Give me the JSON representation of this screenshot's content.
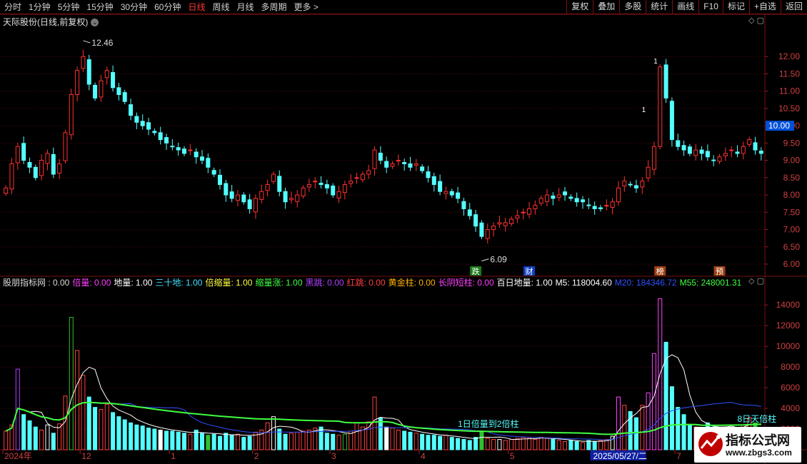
{
  "toolbar": {
    "periods": [
      "分时",
      "1分钟",
      "5分钟",
      "15分钟",
      "30分钟",
      "60分钟",
      "日线",
      "周线",
      "月线",
      "多周期",
      "更多 >"
    ],
    "active_period": "日线",
    "actions": [
      "复权",
      "叠加",
      "多股",
      "统计",
      "画线",
      "F10",
      "标记",
      "+自选",
      "返回"
    ]
  },
  "main_chart": {
    "title": "天际股份(日线,前复权)",
    "price_axis": [
      "12.00",
      "11.50",
      "11.00",
      "10.50",
      "10.00",
      "9.50",
      "9.00",
      "8.50",
      "8.00",
      "7.50",
      "7.00",
      "6.50",
      "6.00"
    ],
    "current_price_label": "10.00",
    "high_label": "12.46",
    "low_label": "6.09",
    "event_markers": [
      "跌",
      "财",
      "榜",
      "预"
    ],
    "spike_labels": [
      "1",
      "1"
    ]
  },
  "indicator": {
    "legend": [
      {
        "text": "股朋指标网 : 0.00",
        "color": "#d8d8d8"
      },
      {
        "text": "倍量: 0.00",
        "color": "#ff40ff"
      },
      {
        "text": "地量: 1.00",
        "color": "#ffffff"
      },
      {
        "text": "三十地: 1.00",
        "color": "#40e0ff"
      },
      {
        "text": "倍缩量: 1.00",
        "color": "#ffff40"
      },
      {
        "text": "缩量涨: 1.00",
        "color": "#40ff40"
      },
      {
        "text": "黑跳: 0.00",
        "color": "#b040ff"
      },
      {
        "text": "红跳: 0.00",
        "color": "#ff4040"
      },
      {
        "text": "黄金柱: 0.00",
        "color": "#ffb000"
      },
      {
        "text": "长阴短柱: 0.00",
        "color": "#ff40ff"
      },
      {
        "text": "百日地量: 1.00",
        "color": "#ffffff"
      },
      {
        "text": "M5: 118004.60",
        "color": "#ffffff"
      },
      {
        "text": "M20: 184346.72",
        "color": "#3050ff"
      },
      {
        "text": "M55: 248001.31",
        "color": "#40ff40"
      }
    ],
    "volume_axis": [
      "14000",
      "12000",
      "10000",
      "8000",
      "6000",
      "4000",
      "2000"
    ],
    "annotations": [
      "1日倍量到2倍柱",
      "8日天倍柱"
    ]
  },
  "time_axis": {
    "labels": [
      "2024年",
      "12",
      "1",
      "2",
      "3",
      "4",
      "5",
      "2025/05/27/二",
      "7"
    ]
  },
  "watermark": {
    "title": "指标公式网",
    "url": "www.zbgs3.com"
  },
  "chart_data": {
    "type": "candlestick",
    "ylim": [
      6.0,
      12.5
    ],
    "volume_ylim": [
      0,
      14500
    ],
    "y_unit": "price",
    "volume_unit": "lots",
    "series": [
      {
        "name": "M5",
        "color": "#ffffff"
      },
      {
        "name": "M20",
        "color": "#3050ff"
      },
      {
        "name": "M55",
        "color": "#40ff40"
      }
    ],
    "close": [
      8.2,
      8.9,
      9.4,
      9.0,
      8.8,
      8.5,
      9.0,
      9.2,
      8.6,
      8.9,
      9.8,
      10.9,
      11.6,
      12.0,
      11.2,
      10.8,
      11.3,
      11.6,
      11.1,
      10.9,
      10.7,
      10.3,
      10.1,
      10.0,
      9.9,
      9.8,
      9.6,
      9.5,
      9.4,
      9.3,
      9.2,
      9.3,
      9.1,
      9.0,
      8.8,
      8.6,
      8.3,
      8.0,
      7.9,
      8.0,
      7.8,
      7.6,
      7.9,
      8.1,
      8.3,
      8.6,
      8.1,
      7.8,
      7.9,
      8.0,
      8.2,
      8.3,
      8.4,
      8.3,
      8.2,
      8.0,
      8.1,
      8.3,
      8.4,
      8.5,
      8.6,
      8.7,
      9.3,
      9.0,
      8.8,
      8.9,
      9.0,
      8.9,
      8.8,
      8.9,
      8.7,
      8.5,
      8.3,
      8.1,
      8.1,
      8.0,
      7.9,
      7.6,
      7.4,
      7.1,
      6.8,
      7.0,
      7.1,
      7.2,
      7.2,
      7.3,
      7.4,
      7.5,
      7.6,
      7.7,
      7.9,
      8.0,
      7.9,
      8.0,
      8.0,
      7.9,
      7.8,
      7.8,
      7.7,
      7.6,
      7.6,
      7.7,
      7.8,
      8.2,
      8.4,
      8.3,
      8.2,
      8.4,
      8.8,
      9.4,
      11.7,
      10.8,
      9.6,
      9.4,
      9.3,
      9.2,
      9.3,
      9.2,
      9.1,
      9.0,
      9.1,
      9.2,
      9.3,
      9.2,
      9.4,
      9.6,
      9.3,
      9.2
    ],
    "volume": [
      1800,
      2400,
      7800,
      3400,
      2800,
      2200,
      1900,
      2400,
      1600,
      2500,
      5200,
      12800,
      9600,
      7200,
      5100,
      4100,
      3900,
      4400,
      3600,
      3200,
      2900,
      2600,
      2400,
      2300,
      2100,
      2000,
      1900,
      1800,
      1800,
      1700,
      1600,
      1500,
      1900,
      1600,
      1400,
      1500,
      1300,
      1600,
      1400,
      1500,
      1200,
      1300,
      1700,
      1900,
      2600,
      3200,
      2000,
      1500,
      1600,
      1700,
      1800,
      1900,
      2100,
      2200,
      1600,
      1500,
      1400,
      1500,
      1800,
      2600,
      2200,
      2700,
      5100,
      3100,
      2200,
      2100,
      1900,
      1800,
      1700,
      1600,
      1500,
      1400,
      1400,
      1300,
      1400,
      1200,
      1100,
      1000,
      900,
      1200,
      1800,
      1100,
      1000,
      1000,
      900,
      1000,
      1100,
      1200,
      1100,
      1000,
      1200,
      1100,
      1000,
      900,
      800,
      900,
      800,
      700,
      900,
      800,
      900,
      1000,
      1300,
      5100,
      4300,
      3700,
      3100,
      4300,
      5500,
      9300,
      14600,
      10400,
      6100,
      4100,
      3400,
      2400,
      2200,
      2000,
      2600,
      2200,
      2000,
      2200,
      2400,
      1900,
      2400,
      3100,
      2600,
      2100
    ]
  }
}
